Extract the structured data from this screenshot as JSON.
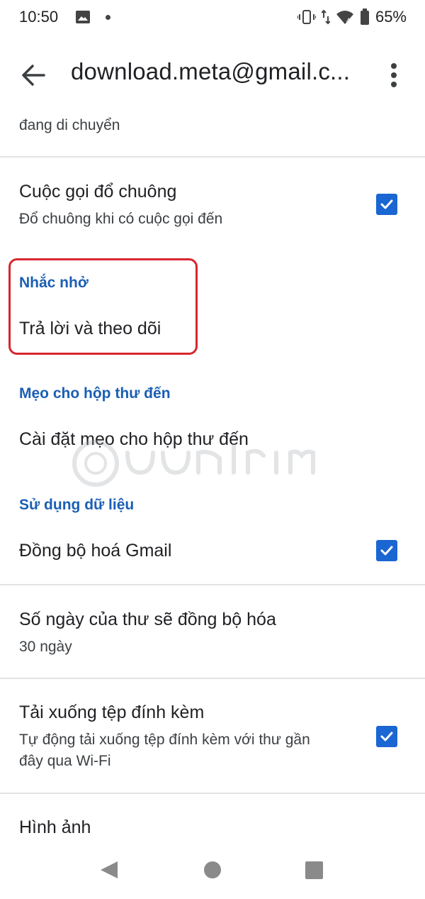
{
  "status_bar": {
    "time": "10:50",
    "battery": "65%",
    "icons": [
      "image-icon",
      "dot-icon",
      "vibrate-icon",
      "data-arrows-icon",
      "wifi-icon",
      "battery-icon"
    ]
  },
  "app_bar": {
    "title": "download.meta@gmail.c...",
    "icons": [
      "back-arrow-icon",
      "more-vert-icon"
    ]
  },
  "list": {
    "partial_item_sub": "đang di chuyển",
    "ringtone_call": {
      "title": "Cuộc gọi đổ chuông",
      "subtitle": "Đổ chuông khi có cuộc gọi đến",
      "checked": true
    },
    "reminders": {
      "header": "Nhắc nhở",
      "item": "Trả lời và theo dõi"
    },
    "inbox_tips": {
      "header": "Mẹo cho hộp thư đến",
      "item": "Cài đặt mẹo cho hộp thư đến"
    },
    "data_usage": {
      "header": "Sử dụng dữ liệu",
      "sync_gmail": {
        "title": "Đồng bộ hoá Gmail",
        "checked": true
      },
      "sync_days": {
        "title": "Số ngày của thư sẽ đồng bộ hóa",
        "subtitle": "30 ngày"
      },
      "download_attachments": {
        "title": "Tải xuống tệp đính kèm",
        "subtitle_line1": "Tự động tải xuống tệp đính kèm với thư gần",
        "subtitle_line2": "đây qua Wi-Fi",
        "checked": true
      },
      "images": {
        "title": "Hình ảnh"
      }
    }
  },
  "colors": {
    "accent": "#1a66d2",
    "section_header": "#1a5fb4",
    "highlight_border": "#d7262e",
    "divider": "#e3e3e3"
  },
  "nav_bar": {
    "icons": [
      "nav-back-icon",
      "nav-home-icon",
      "nav-recents-icon"
    ]
  }
}
